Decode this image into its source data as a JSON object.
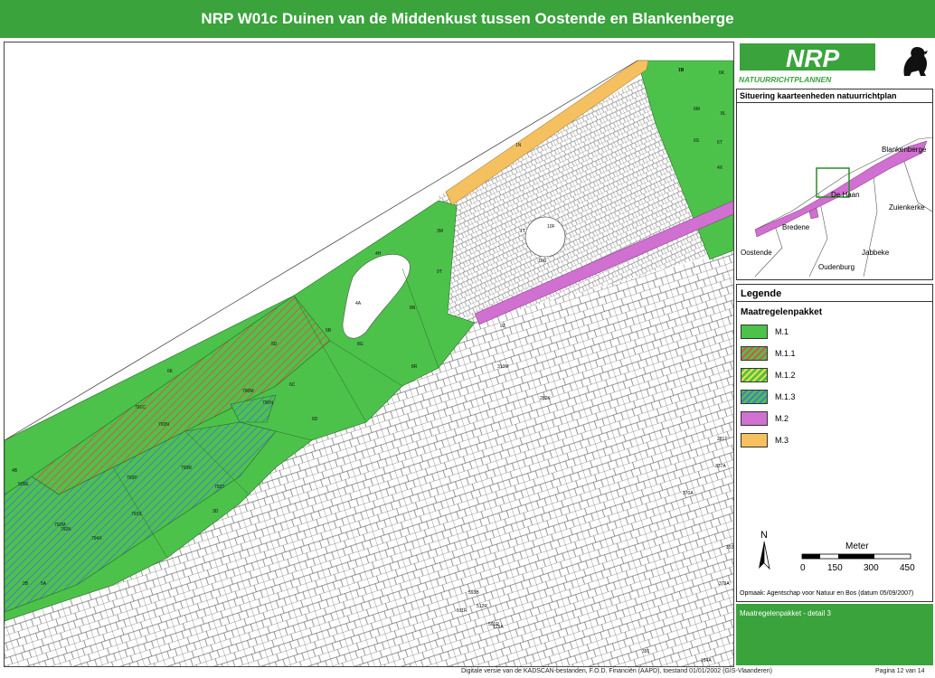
{
  "title": "NRP W01c Duinen van de Middenkust tussen Oostende en Blankenberge",
  "logo": {
    "main": "NRP",
    "sub": "NATUURRICHTPLANNEN"
  },
  "situering": {
    "title": "Situering kaarteenheden natuurrichtplan",
    "towns": [
      "Blankenberge",
      "De Haan",
      "Zuienkerke",
      "Bredene",
      "Oostende",
      "Jabbeke",
      "Oudenburg"
    ]
  },
  "legend": {
    "title": "Legende",
    "subtitle": "Maatregelenpakket",
    "items": [
      {
        "label": "M.1",
        "color": "#4cc24a",
        "pattern": "solid"
      },
      {
        "label": "M.1.1",
        "color": "#4cc24a",
        "pattern": "red-hatch"
      },
      {
        "label": "M.1.2",
        "color": "#4cc24a",
        "pattern": "yellow-hatch"
      },
      {
        "label": "M.1.3",
        "color": "#4cc24a",
        "pattern": "blue-hatch"
      },
      {
        "label": "M.2",
        "color": "#d070d0",
        "pattern": "solid"
      },
      {
        "label": "M.3",
        "color": "#f5c060",
        "pattern": "solid"
      }
    ]
  },
  "scale": {
    "north": "N",
    "unit": "Meter",
    "ticks": [
      "0",
      "150",
      "300",
      "450"
    ]
  },
  "credit": "Opmaak: Agentschap voor Natuur en Bos (datum 05/09/2007)",
  "detail": "Maatregelenpakket - detail 3",
  "footer": {
    "source": "Digitale versie van de KADSCAN-bestanden, F.O.D. Financiën (AAPD), toestand 01/01/2002 (GIS-Vlaanderen)",
    "page": "Pagina 12 van 14"
  },
  "map_labels": [
    "7H",
    "6K",
    "6M",
    "8L",
    "6S",
    "6T",
    "4X",
    "1N",
    "3M",
    "4H",
    "9T",
    "4A",
    "8N",
    "5D",
    "5B",
    "8G",
    "6K",
    "8R",
    "791C",
    "790M",
    "6C",
    "790N",
    "793N",
    "6D",
    "4B",
    "793P",
    "793R",
    "793T",
    "793S",
    "792M",
    "792K",
    "794X",
    "3D",
    "10F",
    "10G",
    "1T",
    "9Z",
    "310M",
    "282K",
    "281T",
    "337A",
    "370A",
    "353",
    "379A",
    "391",
    "154A",
    "125A",
    "593B",
    "512R",
    "511R",
    "501R",
    "505E",
    "5A",
    "2B",
    "1E"
  ]
}
